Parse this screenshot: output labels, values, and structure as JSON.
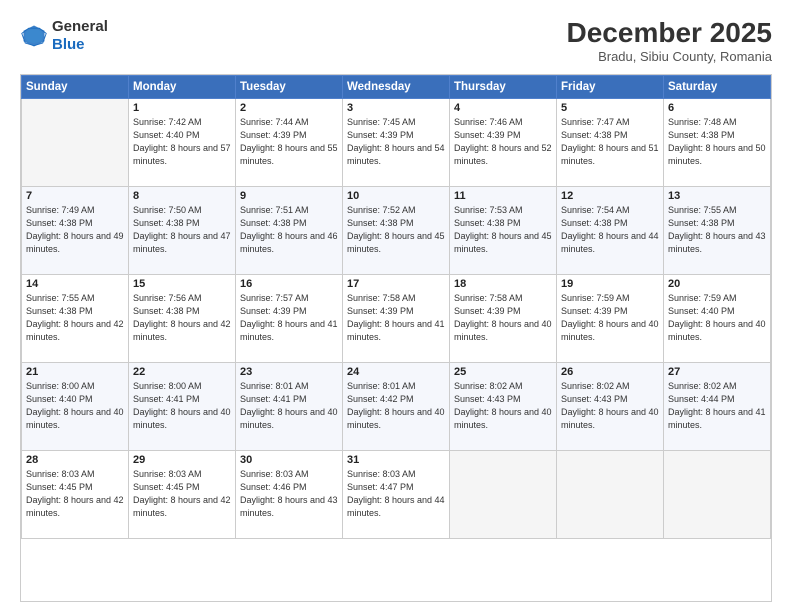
{
  "header": {
    "logo_general": "General",
    "logo_blue": "Blue",
    "month_title": "December 2025",
    "subtitle": "Bradu, Sibiu County, Romania"
  },
  "days_of_week": [
    "Sunday",
    "Monday",
    "Tuesday",
    "Wednesday",
    "Thursday",
    "Friday",
    "Saturday"
  ],
  "weeks": [
    [
      {
        "day": "",
        "sunrise": "",
        "sunset": "",
        "daylight": ""
      },
      {
        "day": "1",
        "sunrise": "Sunrise: 7:42 AM",
        "sunset": "Sunset: 4:40 PM",
        "daylight": "Daylight: 8 hours and 57 minutes."
      },
      {
        "day": "2",
        "sunrise": "Sunrise: 7:44 AM",
        "sunset": "Sunset: 4:39 PM",
        "daylight": "Daylight: 8 hours and 55 minutes."
      },
      {
        "day": "3",
        "sunrise": "Sunrise: 7:45 AM",
        "sunset": "Sunset: 4:39 PM",
        "daylight": "Daylight: 8 hours and 54 minutes."
      },
      {
        "day": "4",
        "sunrise": "Sunrise: 7:46 AM",
        "sunset": "Sunset: 4:39 PM",
        "daylight": "Daylight: 8 hours and 52 minutes."
      },
      {
        "day": "5",
        "sunrise": "Sunrise: 7:47 AM",
        "sunset": "Sunset: 4:38 PM",
        "daylight": "Daylight: 8 hours and 51 minutes."
      },
      {
        "day": "6",
        "sunrise": "Sunrise: 7:48 AM",
        "sunset": "Sunset: 4:38 PM",
        "daylight": "Daylight: 8 hours and 50 minutes."
      }
    ],
    [
      {
        "day": "7",
        "sunrise": "Sunrise: 7:49 AM",
        "sunset": "Sunset: 4:38 PM",
        "daylight": "Daylight: 8 hours and 49 minutes."
      },
      {
        "day": "8",
        "sunrise": "Sunrise: 7:50 AM",
        "sunset": "Sunset: 4:38 PM",
        "daylight": "Daylight: 8 hours and 47 minutes."
      },
      {
        "day": "9",
        "sunrise": "Sunrise: 7:51 AM",
        "sunset": "Sunset: 4:38 PM",
        "daylight": "Daylight: 8 hours and 46 minutes."
      },
      {
        "day": "10",
        "sunrise": "Sunrise: 7:52 AM",
        "sunset": "Sunset: 4:38 PM",
        "daylight": "Daylight: 8 hours and 45 minutes."
      },
      {
        "day": "11",
        "sunrise": "Sunrise: 7:53 AM",
        "sunset": "Sunset: 4:38 PM",
        "daylight": "Daylight: 8 hours and 45 minutes."
      },
      {
        "day": "12",
        "sunrise": "Sunrise: 7:54 AM",
        "sunset": "Sunset: 4:38 PM",
        "daylight": "Daylight: 8 hours and 44 minutes."
      },
      {
        "day": "13",
        "sunrise": "Sunrise: 7:55 AM",
        "sunset": "Sunset: 4:38 PM",
        "daylight": "Daylight: 8 hours and 43 minutes."
      }
    ],
    [
      {
        "day": "14",
        "sunrise": "Sunrise: 7:55 AM",
        "sunset": "Sunset: 4:38 PM",
        "daylight": "Daylight: 8 hours and 42 minutes."
      },
      {
        "day": "15",
        "sunrise": "Sunrise: 7:56 AM",
        "sunset": "Sunset: 4:38 PM",
        "daylight": "Daylight: 8 hours and 42 minutes."
      },
      {
        "day": "16",
        "sunrise": "Sunrise: 7:57 AM",
        "sunset": "Sunset: 4:39 PM",
        "daylight": "Daylight: 8 hours and 41 minutes."
      },
      {
        "day": "17",
        "sunrise": "Sunrise: 7:58 AM",
        "sunset": "Sunset: 4:39 PM",
        "daylight": "Daylight: 8 hours and 41 minutes."
      },
      {
        "day": "18",
        "sunrise": "Sunrise: 7:58 AM",
        "sunset": "Sunset: 4:39 PM",
        "daylight": "Daylight: 8 hours and 40 minutes."
      },
      {
        "day": "19",
        "sunrise": "Sunrise: 7:59 AM",
        "sunset": "Sunset: 4:39 PM",
        "daylight": "Daylight: 8 hours and 40 minutes."
      },
      {
        "day": "20",
        "sunrise": "Sunrise: 7:59 AM",
        "sunset": "Sunset: 4:40 PM",
        "daylight": "Daylight: 8 hours and 40 minutes."
      }
    ],
    [
      {
        "day": "21",
        "sunrise": "Sunrise: 8:00 AM",
        "sunset": "Sunset: 4:40 PM",
        "daylight": "Daylight: 8 hours and 40 minutes."
      },
      {
        "day": "22",
        "sunrise": "Sunrise: 8:00 AM",
        "sunset": "Sunset: 4:41 PM",
        "daylight": "Daylight: 8 hours and 40 minutes."
      },
      {
        "day": "23",
        "sunrise": "Sunrise: 8:01 AM",
        "sunset": "Sunset: 4:41 PM",
        "daylight": "Daylight: 8 hours and 40 minutes."
      },
      {
        "day": "24",
        "sunrise": "Sunrise: 8:01 AM",
        "sunset": "Sunset: 4:42 PM",
        "daylight": "Daylight: 8 hours and 40 minutes."
      },
      {
        "day": "25",
        "sunrise": "Sunrise: 8:02 AM",
        "sunset": "Sunset: 4:43 PM",
        "daylight": "Daylight: 8 hours and 40 minutes."
      },
      {
        "day": "26",
        "sunrise": "Sunrise: 8:02 AM",
        "sunset": "Sunset: 4:43 PM",
        "daylight": "Daylight: 8 hours and 40 minutes."
      },
      {
        "day": "27",
        "sunrise": "Sunrise: 8:02 AM",
        "sunset": "Sunset: 4:44 PM",
        "daylight": "Daylight: 8 hours and 41 minutes."
      }
    ],
    [
      {
        "day": "28",
        "sunrise": "Sunrise: 8:03 AM",
        "sunset": "Sunset: 4:45 PM",
        "daylight": "Daylight: 8 hours and 42 minutes."
      },
      {
        "day": "29",
        "sunrise": "Sunrise: 8:03 AM",
        "sunset": "Sunset: 4:45 PM",
        "daylight": "Daylight: 8 hours and 42 minutes."
      },
      {
        "day": "30",
        "sunrise": "Sunrise: 8:03 AM",
        "sunset": "Sunset: 4:46 PM",
        "daylight": "Daylight: 8 hours and 43 minutes."
      },
      {
        "day": "31",
        "sunrise": "Sunrise: 8:03 AM",
        "sunset": "Sunset: 4:47 PM",
        "daylight": "Daylight: 8 hours and 44 minutes."
      },
      {
        "day": "",
        "sunrise": "",
        "sunset": "",
        "daylight": ""
      },
      {
        "day": "",
        "sunrise": "",
        "sunset": "",
        "daylight": ""
      },
      {
        "day": "",
        "sunrise": "",
        "sunset": "",
        "daylight": ""
      }
    ]
  ]
}
